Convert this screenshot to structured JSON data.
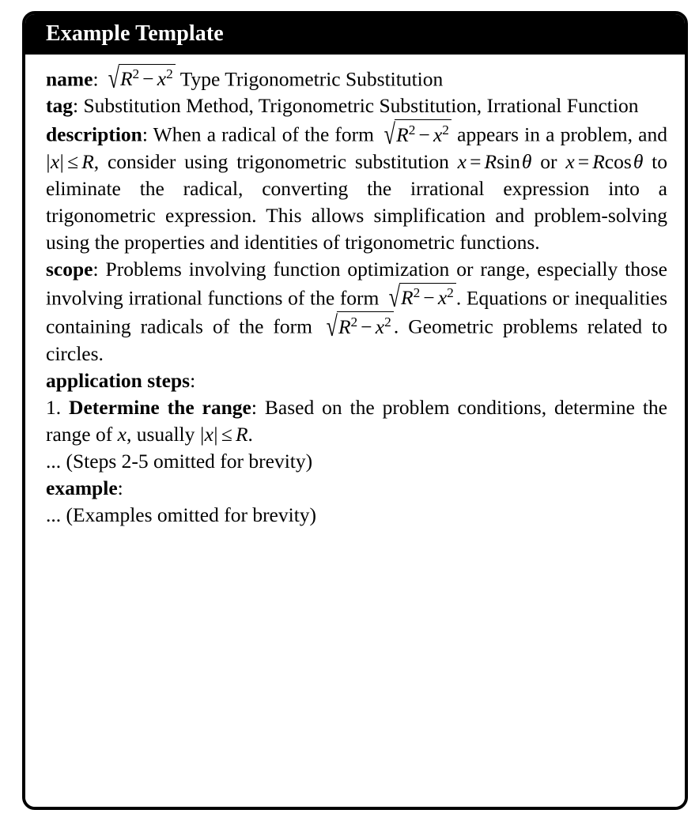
{
  "box": {
    "title": "Example Template"
  },
  "fields": {
    "name": {
      "label": "name",
      "sep": ": ",
      "text_after_math": " Type Trigonometric Substitution",
      "full_text": "name: sqrt(R^2 - x^2) Type Trigonometric Substitution"
    },
    "tag": {
      "label": "tag",
      "sep": ": ",
      "value": "Substitution Method, Trigonometric Substitution, Irrational Function",
      "full_text": "tag: Substitution Method, Trigonometric Substitution, Irrational Function"
    },
    "description": {
      "label": "description",
      "sep": ": ",
      "part1": "When a radical of the form ",
      "part2": " appears in a problem, and ",
      "part3": ", consider using trigonometric substitution ",
      "part4": " or ",
      "part5": " to eliminate the radical, converting the irrational expression into a trigonometric expression. This allows simplification and problem-solving using the properties and identities of trigonometric functions.",
      "full_text": "description: When a radical of the form sqrt(R^2 - x^2) appears in a problem, and |x| <= R, consider using trigonometric substitution x = R sin(theta) or x = R cos(theta) to eliminate the radical, converting the irrational expression into a trigonometric expression. This allows simplification and problem-solving using the properties and identities of trigonometric functions."
    },
    "scope": {
      "label": "scope",
      "sep": ":  ",
      "part1": "Problems involving function optimization or range, especially those involving irrational functions of the form ",
      "part2": ". Equations or inequalities containing radicals of the form ",
      "part3": ". Geometric problems related to circles.",
      "full_text": "scope: Problems involving function optimization or range, especially those involving irrational functions of the form sqrt(R^2 - x^2). Equations or inequalities containing radicals of the form sqrt(R^2 - x^2). Geometric problems related to circles."
    },
    "application_steps": {
      "label": "application steps",
      "sep": ":",
      "step1": {
        "number": "1. ",
        "title": "Determine the range",
        "sep": ": ",
        "part1": "Based on the problem conditions, determine the range of ",
        "part2": ", usually ",
        "part3": ".",
        "full_text": "1. Determine the range: Based on the problem conditions, determine the range of x, usually |x| <= R."
      },
      "omitted_note": "... (Steps 2-5 omitted for brevity)"
    },
    "example": {
      "label": "example",
      "sep": ":",
      "omitted_note": "... (Examples omitted for brevity)"
    }
  },
  "math": {
    "radical_sign": "√",
    "minus": "−",
    "leq": "≤",
    "theta": "θ",
    "equals": "=",
    "R": "R",
    "x": "x",
    "two": "2",
    "sin": "sin",
    "cos": "cos",
    "bar": "|"
  },
  "colors": {
    "title_bar_background": "#000000",
    "title_text": "#ffffff",
    "body_background": "#ffffff",
    "body_text": "#000000",
    "border": "#000000"
  }
}
